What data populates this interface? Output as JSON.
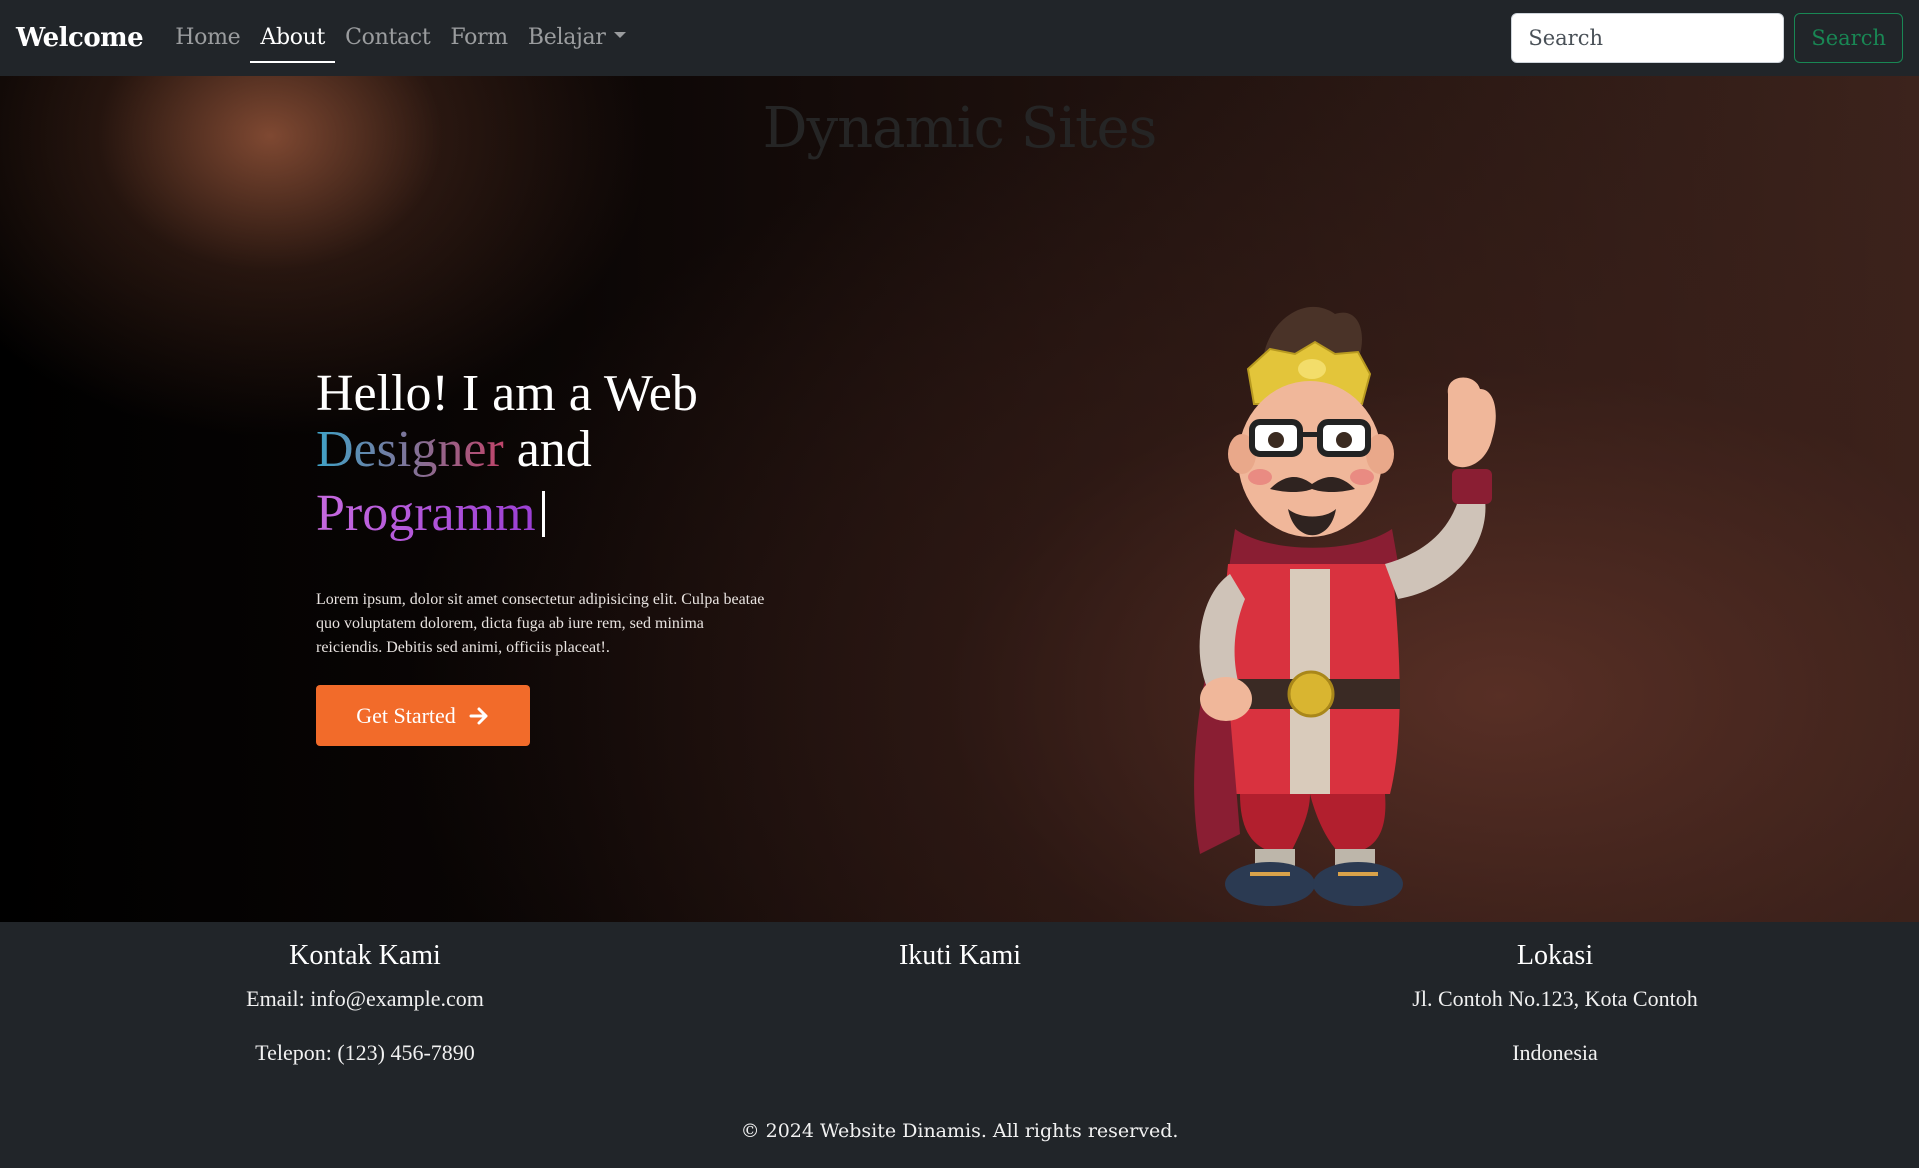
{
  "navbar": {
    "brand": "Welcome",
    "links": [
      "Home",
      "About",
      "Contact",
      "Form"
    ],
    "dropdown_label": "Belajar",
    "active": "About",
    "search_placeholder": "Search",
    "search_button": "Search"
  },
  "hero": {
    "title": "Dynamic Sites",
    "headline_line1": "Hello! I am a Web",
    "headline_word_designer": "Designer",
    "headline_and": "and",
    "headline_typed": "Programm",
    "description": "Lorem ipsum, dolor sit amet consectetur adipisicing elit. Culpa beatae quo voluptatem dolorem, dicta fuga ab iure rem, sed minima reiciendis. Debitis sed animi, officiis placeat!.",
    "cta_label": "Get Started",
    "cta_icon": "arrow-right-icon",
    "image": "cartoon-character-illustration"
  },
  "footer": {
    "contact": {
      "title": "Kontak Kami",
      "email": "Email: info@example.com",
      "phone": "Telepon: (123) 456-7890"
    },
    "follow": {
      "title": "Ikuti Kami"
    },
    "location": {
      "title": "Lokasi",
      "address": "Jl. Contoh No.123, Kota Contoh",
      "country": "Indonesia"
    },
    "copyright": "© 2024 Website Dinamis. All rights reserved."
  },
  "colors": {
    "navbar_bg": "#212529",
    "cta_bg": "#f26b2a",
    "search_button": "#198754"
  }
}
